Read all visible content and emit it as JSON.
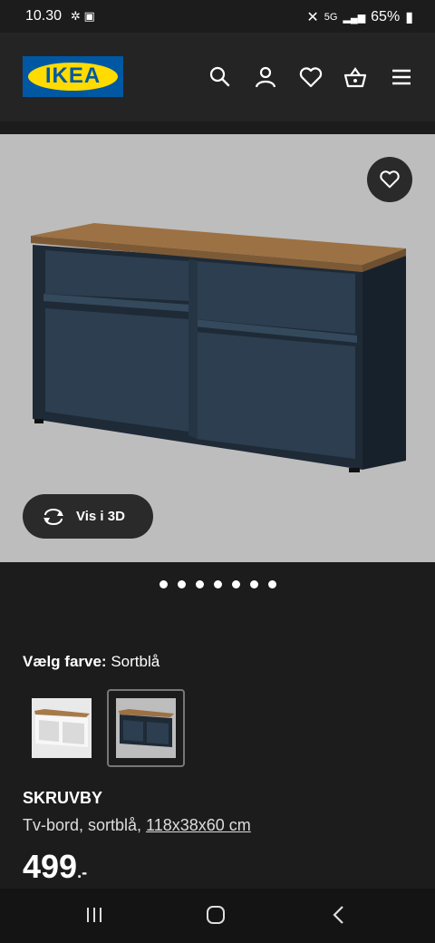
{
  "statusbar": {
    "time": "10.30",
    "network": "5G",
    "battery": "65%"
  },
  "header": {
    "logo_text": "IKEA"
  },
  "product": {
    "view3d_label": "Vis i 3D",
    "colour_label": "Vælg farve:",
    "colour_value": "Sortblå",
    "name": "SKRUVBY",
    "desc_prefix": "Tv-bord, sortblå, ",
    "dimensions": "118x38x60 cm",
    "price": "499",
    "price_suffix": ".-",
    "image_count": 7
  },
  "colors": {
    "brand_blue": "#0058a3",
    "brand_yellow": "#ffdb00",
    "top_wood": "#9c7144",
    "body_navy": "#1e2a36"
  }
}
